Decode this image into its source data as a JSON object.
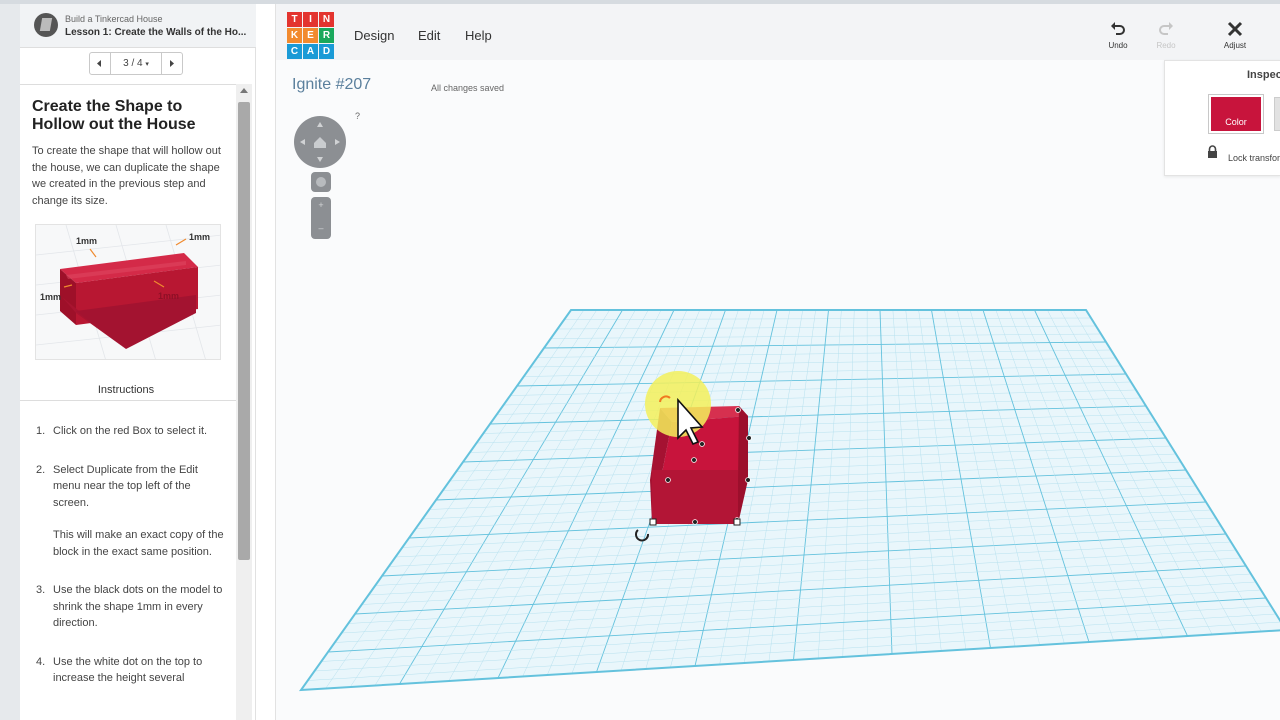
{
  "lesson": {
    "course_title": "Build a Tinkercad House",
    "lesson_title": "Lesson 1: Create the Walls of the Ho...",
    "pager": {
      "label": "3 / 4"
    },
    "step_title": "Create the Shape to Hollow out the House",
    "step_description": "To create the shape that will hollow out the house, we can duplicate the shape we created in the previous step and change its size.",
    "preview_labels": [
      "1mm",
      "1mm",
      "1mm",
      "1mm"
    ],
    "instructions_label": "Instructions",
    "steps": [
      {
        "num": "1.",
        "text": "Click on the red Box to select it."
      },
      {
        "num": "2.",
        "text": "Select Duplicate from the Edit menu near the top left of the screen.",
        "note": "This will make an exact copy of the block in the exact same position."
      },
      {
        "num": "3.",
        "text": "Use the black dots on the model to shrink the shape 1mm in every direction."
      },
      {
        "num": "4.",
        "text": "Use the white dot on the top to increase the height several"
      }
    ]
  },
  "app": {
    "logo_letters": [
      "TIN",
      "KER",
      "CAD"
    ],
    "menu": [
      "Design",
      "Edit",
      "Help"
    ],
    "toolbar": {
      "undo": "Undo",
      "redo": "Redo",
      "adjust": "Adjust"
    },
    "doc_title": "Ignite #207",
    "save_status": "All changes saved",
    "help_q": "?",
    "inspector": {
      "title": "Inspector",
      "color_label": "Color",
      "lock_label": "Lock transforms"
    }
  },
  "colors": {
    "shape": "#c8143c",
    "grid": "#b7e1ef",
    "grid_major": "#64c2dd",
    "doc_title": "#5a7f9c",
    "logo_red": "#e3342f",
    "logo_orange": "#f28a2e",
    "logo_blue": "#1a9ad6",
    "logo_green": "#1aa85c"
  },
  "icons": [
    "undo-icon",
    "redo-icon",
    "adjust-icon",
    "lock-icon",
    "nav-cube-icon",
    "cursor-icon",
    "rotate-handle-icon"
  ]
}
